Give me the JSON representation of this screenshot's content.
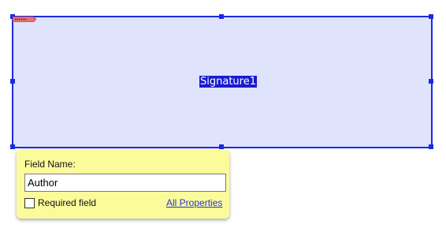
{
  "signature_field": {
    "name": "Signature1",
    "flag_icon": "signature-flag-icon"
  },
  "popup": {
    "field_name_label": "Field Name:",
    "field_name_value": "Author",
    "required_field_label": "Required field",
    "required_field_checked": false,
    "all_properties_link": "All Properties"
  },
  "colors": {
    "field_fill": "#dfe3fb",
    "field_border": "#1a2be0",
    "popup_bg": "#fcfb9c",
    "link": "#1f35d8"
  }
}
